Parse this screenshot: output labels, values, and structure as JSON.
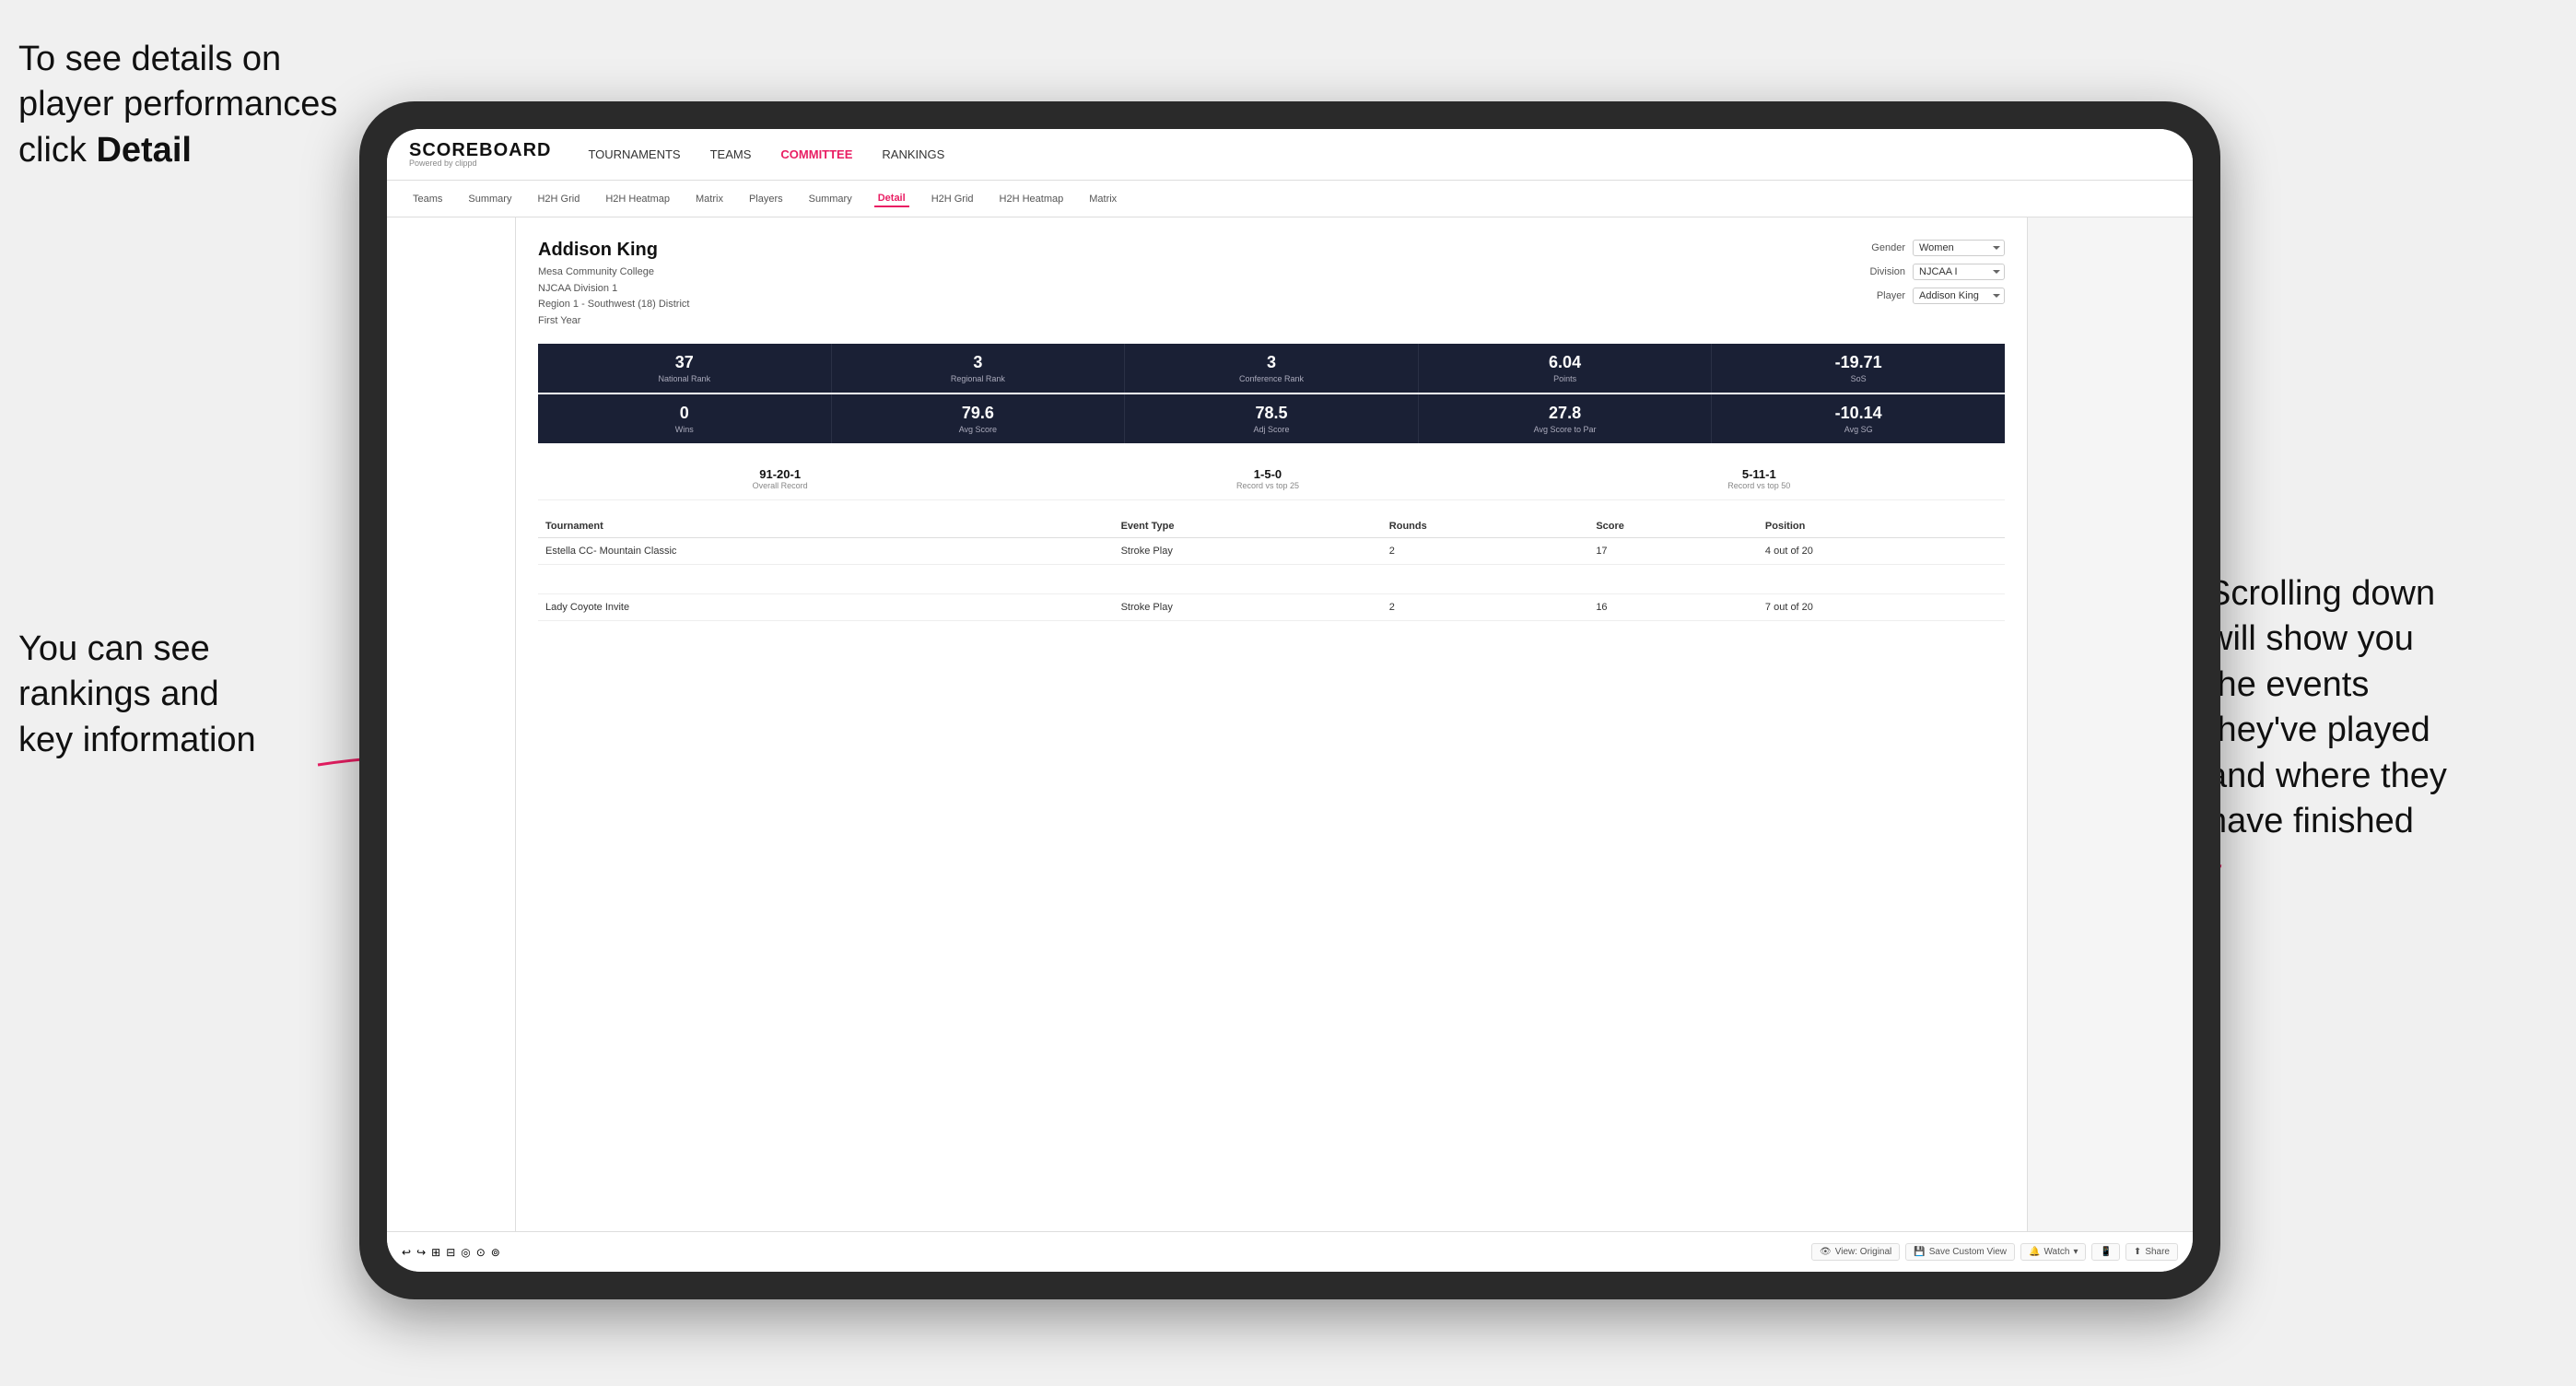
{
  "annotations": {
    "topleft": "To see details on player performances click ",
    "topleft_bold": "Detail",
    "bottomleft_line1": "You can see",
    "bottomleft_line2": "rankings and",
    "bottomleft_line3": "key information",
    "right_line1": "Scrolling down",
    "right_line2": "will show you",
    "right_line3": "the events",
    "right_line4": "they've played",
    "right_line5": "and where they",
    "right_line6": "have finished"
  },
  "header": {
    "logo": "SCOREBOARD",
    "logo_sub": "Powered by clippd",
    "nav": [
      {
        "id": "tournaments",
        "label": "TOURNAMENTS"
      },
      {
        "id": "teams",
        "label": "TEAMS"
      },
      {
        "id": "committee",
        "label": "COMMITTEE",
        "active": true
      },
      {
        "id": "rankings",
        "label": "RANKINGS"
      }
    ]
  },
  "sub_nav": [
    {
      "id": "teams",
      "label": "Teams"
    },
    {
      "id": "summary",
      "label": "Summary"
    },
    {
      "id": "h2h-grid",
      "label": "H2H Grid"
    },
    {
      "id": "h2h-heatmap",
      "label": "H2H Heatmap"
    },
    {
      "id": "matrix",
      "label": "Matrix"
    },
    {
      "id": "players",
      "label": "Players"
    },
    {
      "id": "summary2",
      "label": "Summary"
    },
    {
      "id": "detail",
      "label": "Detail",
      "active": true
    },
    {
      "id": "h2h-grid2",
      "label": "H2H Grid"
    },
    {
      "id": "h2h-heatmap2",
      "label": "H2H Heatmap"
    },
    {
      "id": "matrix2",
      "label": "Matrix"
    }
  ],
  "player": {
    "name": "Addison King",
    "school": "Mesa Community College",
    "division": "NJCAA Division 1",
    "region": "Region 1 - Southwest (18) District",
    "year": "First Year"
  },
  "filters": {
    "gender_label": "Gender",
    "gender_value": "Women",
    "division_label": "Division",
    "division_value": "NJCAA I",
    "player_label": "Player",
    "player_value": "Addison King"
  },
  "stats_row1": [
    {
      "value": "37",
      "label": "National Rank"
    },
    {
      "value": "3",
      "label": "Regional Rank"
    },
    {
      "value": "3",
      "label": "Conference Rank"
    },
    {
      "value": "6.04",
      "label": "Points"
    },
    {
      "value": "-19.71",
      "label": "SoS"
    }
  ],
  "stats_row2": [
    {
      "value": "0",
      "label": "Wins"
    },
    {
      "value": "79.6",
      "label": "Avg Score"
    },
    {
      "value": "78.5",
      "label": "Adj Score"
    },
    {
      "value": "27.8",
      "label": "Avg Score to Par"
    },
    {
      "value": "-10.14",
      "label": "Avg SG"
    }
  ],
  "records": [
    {
      "value": "91-20-1",
      "label": "Overall Record"
    },
    {
      "value": "1-5-0",
      "label": "Record vs top 25"
    },
    {
      "value": "5-11-1",
      "label": "Record vs top 50"
    }
  ],
  "table": {
    "columns": [
      "Tournament",
      "Event Type",
      "Rounds",
      "Score",
      "Position"
    ],
    "rows": [
      {
        "tournament": "Estella CC- Mountain Classic",
        "event_type": "Stroke Play",
        "rounds": "2",
        "score": "17",
        "position": "4 out of 20"
      },
      {
        "tournament": "",
        "event_type": "",
        "rounds": "",
        "score": "",
        "position": ""
      },
      {
        "tournament": "Lady Coyote Invite",
        "event_type": "Stroke Play",
        "rounds": "2",
        "score": "16",
        "position": "7 out of 20"
      }
    ]
  },
  "toolbar": {
    "undo_label": "↩",
    "redo_label": "↪",
    "view_original": "View: Original",
    "save_custom": "Save Custom View",
    "watch": "Watch",
    "share": "Share"
  }
}
